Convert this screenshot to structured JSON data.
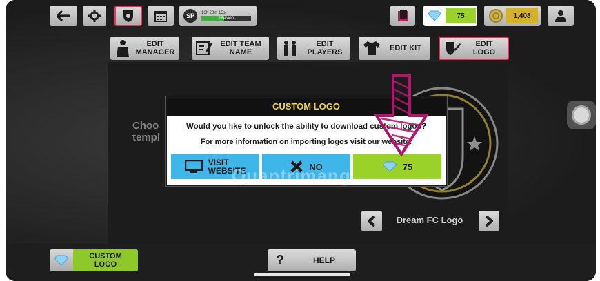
{
  "topbar": {
    "sp_label": "SP",
    "sp_timer": "16h 23m 15s",
    "sp_progress_text": "184/400",
    "sp_progress": 0.46,
    "gems": "75",
    "coins": "1,408"
  },
  "tabs": [
    {
      "label": "EDIT\nMANAGER"
    },
    {
      "label": "EDIT TEAM\nNAME"
    },
    {
      "label": "EDIT\nPLAYERS"
    },
    {
      "label": "EDIT KIT"
    },
    {
      "label": "EDIT\nLOGO"
    }
  ],
  "background": {
    "choose_text_1": "Choo",
    "choose_text_2": "templ",
    "logo_name": "Dream FC Logo"
  },
  "dialog": {
    "title": "CUSTOM LOGO",
    "message": "Would you like to unlock the ability to download custom logos?",
    "sub": "For more information on importing logos visit our website.",
    "visit_label": "VISIT\nWEBSITE",
    "no_label": "NO",
    "buy_label": "75"
  },
  "bottom": {
    "custom_logo_label": "CUSTOM\nLOGO",
    "help_q": "?",
    "help_label": "HELP"
  },
  "watermark": "Quantrimang",
  "colors": {
    "gem_green": "#9ad22a",
    "coin_gold": "#d6b226",
    "dialog_blue": "#3fb6ea",
    "title_yellow": "#f2d33a",
    "active_tab_border": "#e0355e",
    "hint_arrow": "#b3156e"
  }
}
